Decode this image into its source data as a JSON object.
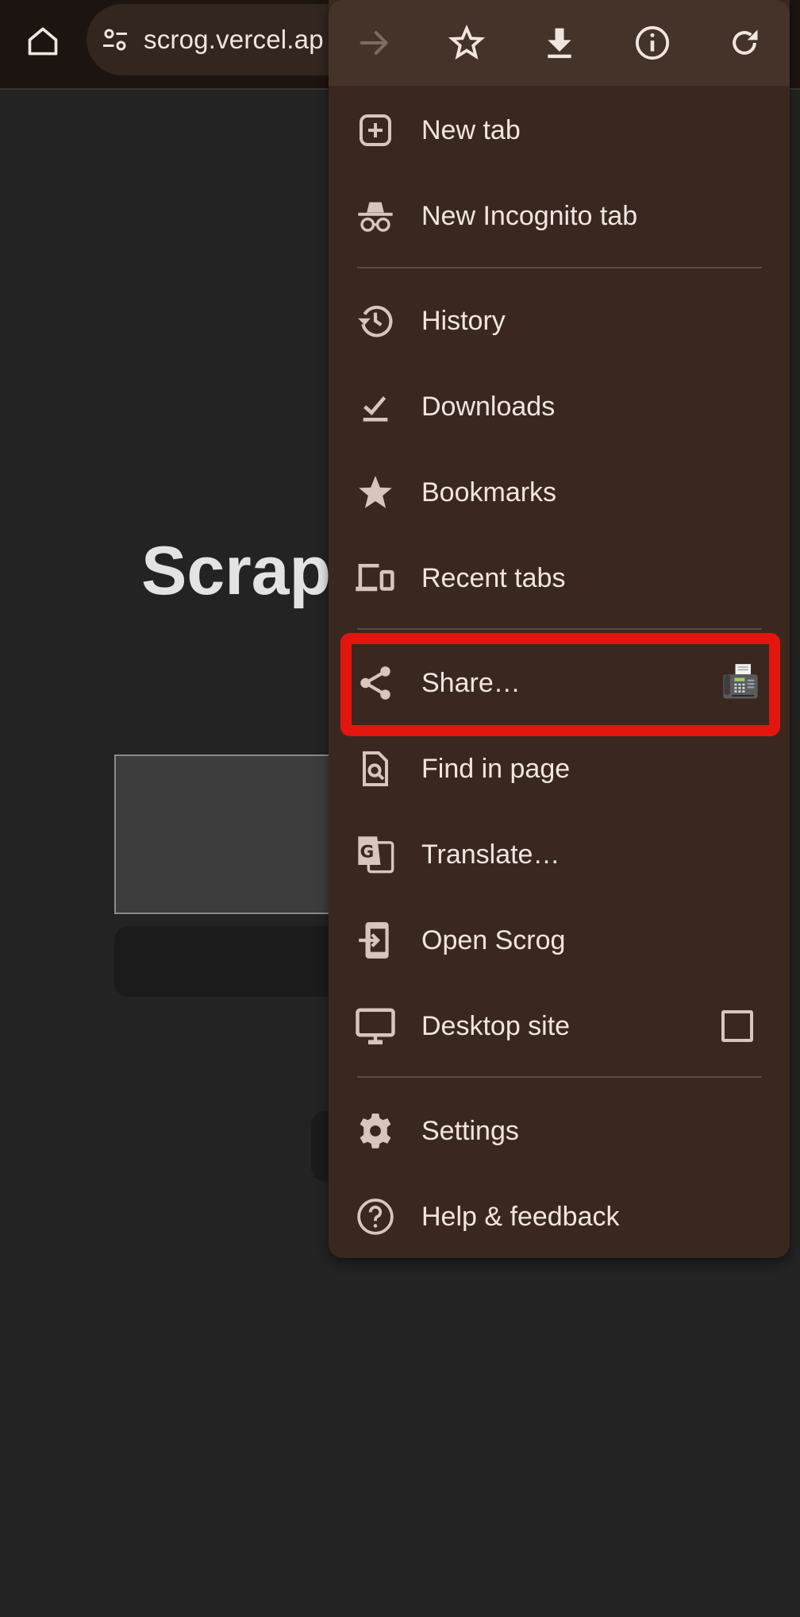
{
  "browser": {
    "url": "scrog.vercel.app",
    "url_visible": "scrog.vercel.ap",
    "home_icon": "home-icon",
    "site_info_icon": "tune-icon"
  },
  "page": {
    "title_visible": "Scrapl"
  },
  "menu": {
    "top_actions": [
      {
        "name": "forward",
        "icon": "arrow-right-icon",
        "enabled": false
      },
      {
        "name": "bookmark",
        "icon": "star-outline-icon",
        "enabled": true
      },
      {
        "name": "download",
        "icon": "download-icon",
        "enabled": true
      },
      {
        "name": "page-info",
        "icon": "info-icon",
        "enabled": true
      },
      {
        "name": "reload",
        "icon": "reload-icon",
        "enabled": true
      }
    ],
    "items": [
      {
        "label": "New tab",
        "icon": "new-tab-icon"
      },
      {
        "label": "New Incognito tab",
        "icon": "incognito-icon"
      },
      {
        "label": "History",
        "icon": "history-icon"
      },
      {
        "label": "Downloads",
        "icon": "downloads-icon"
      },
      {
        "label": "Bookmarks",
        "icon": "star-icon"
      },
      {
        "label": "Recent tabs",
        "icon": "devices-icon"
      },
      {
        "label": "Share…",
        "icon": "share-icon",
        "trailing": "fax-icon",
        "highlighted": true
      },
      {
        "label": "Find in page",
        "icon": "find-in-page-icon"
      },
      {
        "label": "Translate…",
        "icon": "translate-icon"
      },
      {
        "label": "Open Scrog",
        "icon": "open-in-app-icon"
      },
      {
        "label": "Desktop site",
        "icon": "desktop-icon",
        "checkbox": false
      },
      {
        "label": "Settings",
        "icon": "gear-icon"
      },
      {
        "label": "Help & feedback",
        "icon": "help-icon"
      }
    ]
  },
  "colors": {
    "toolbar_bg": "#1b1410",
    "omnibox_bg": "#33261f",
    "menu_bg": "#3a2820",
    "menu_top_bg": "#45332a",
    "icon": "#d6c6bd",
    "text": "#f1e6df",
    "highlight": "#e2160e",
    "page_bg": "#232323"
  }
}
